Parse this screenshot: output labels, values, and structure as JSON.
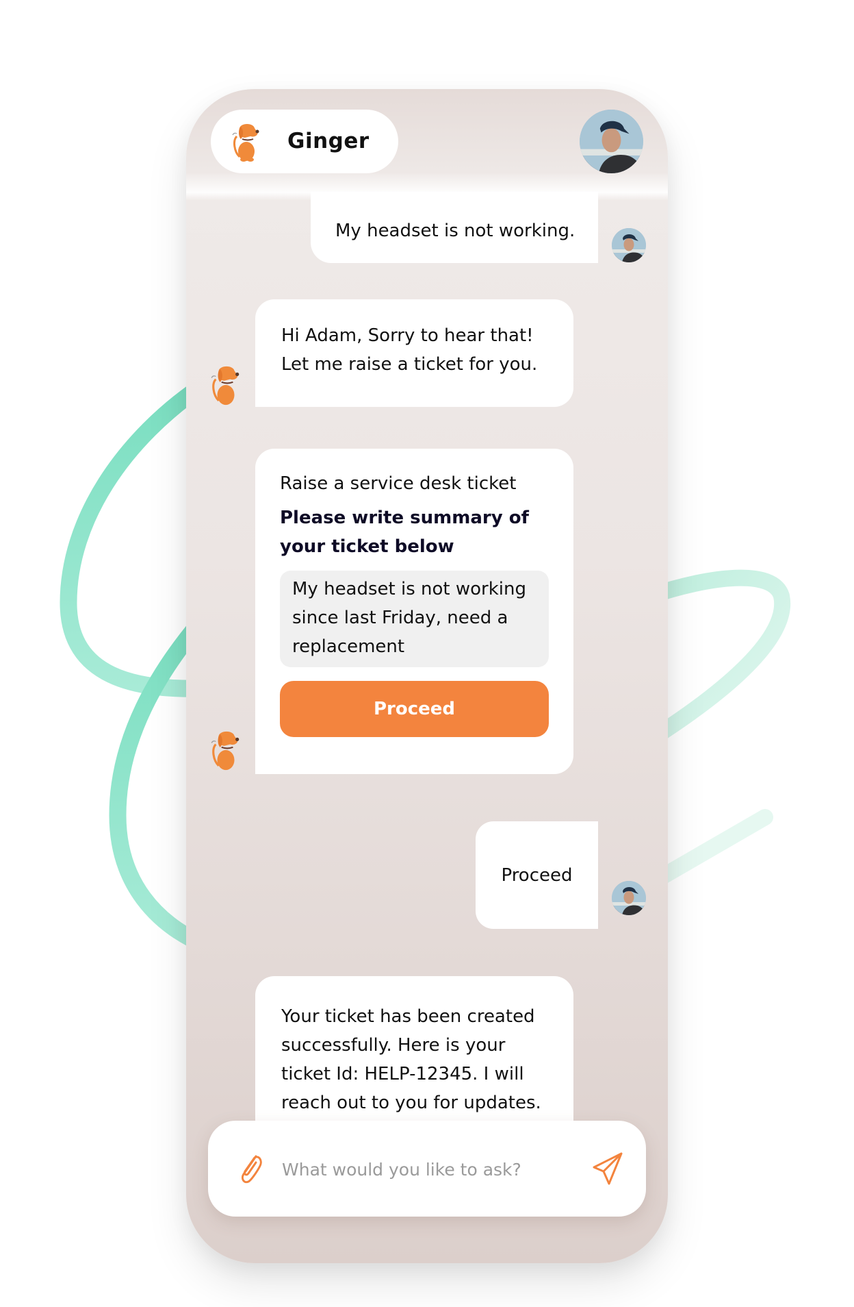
{
  "colors": {
    "accent": "#F3843E",
    "swirl": "#7EE0C3",
    "bubble": "#FFFFFF",
    "textarea_bg": "#F0F0F0",
    "heading": "#0E0B26"
  },
  "header": {
    "bot_name": "Ginger",
    "bot_icon": "dog-mascot-icon",
    "user_avatar": "user-avatar-photo"
  },
  "messages": [
    {
      "sender": "user",
      "text": "My headset is not working."
    },
    {
      "sender": "bot",
      "lines": [
        "Hi Adam, Sorry to hear that!",
        "Let me raise a ticket for you."
      ]
    },
    {
      "sender": "bot",
      "type": "form",
      "title": "Raise a service desk ticket",
      "heading": "Please write summary of your ticket below",
      "textarea_value": "My headset is not working since last Friday, need a replacement",
      "button_label": "Proceed"
    },
    {
      "sender": "user",
      "text": "Proceed"
    },
    {
      "sender": "bot",
      "text": "Your ticket has been created successfully. Here is your ticket Id: HELP-12345. I will reach out to you for updates."
    }
  ],
  "composer": {
    "placeholder": "What would you like to ask?",
    "value": "",
    "attach_icon": "paperclip-icon",
    "send_icon": "send-icon"
  }
}
